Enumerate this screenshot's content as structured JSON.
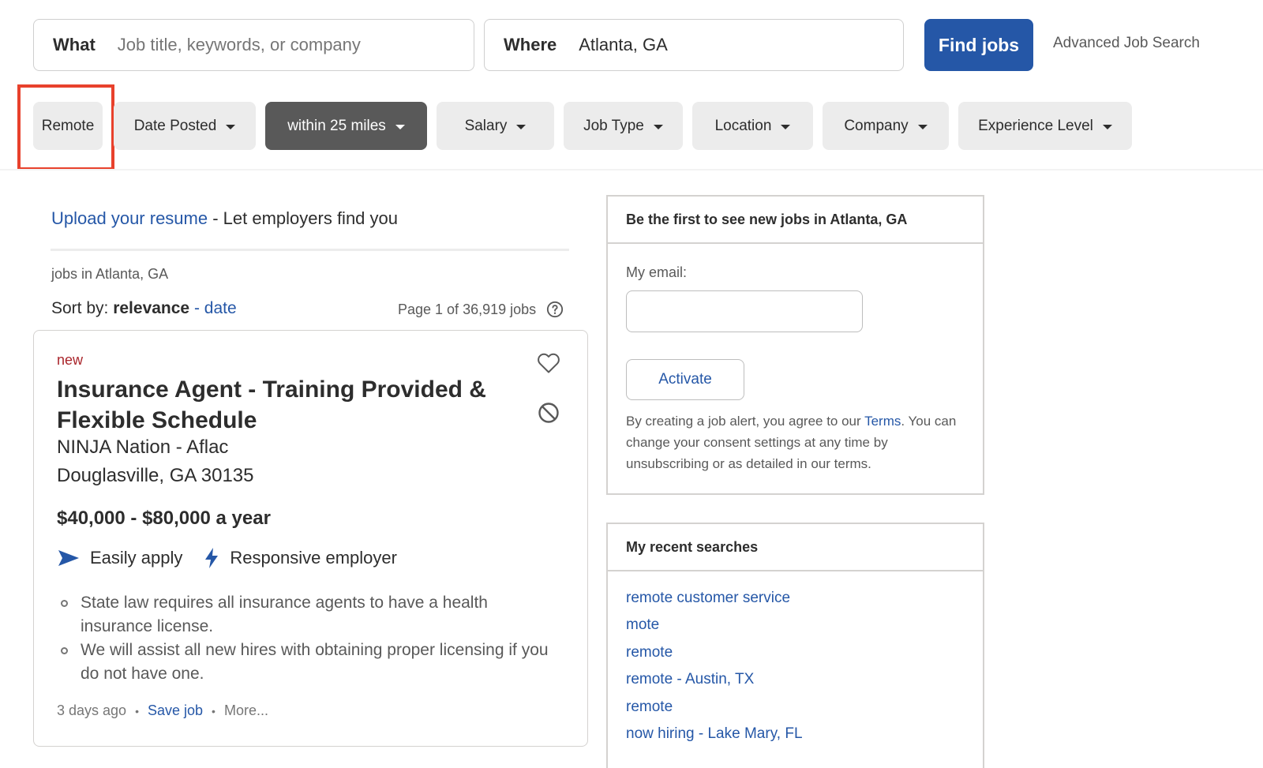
{
  "search": {
    "what_label": "What",
    "what_placeholder": "Job title, keywords, or company",
    "where_label": "Where",
    "where_value": "Atlanta, GA",
    "find_button": "Find jobs",
    "advanced_link": "Advanced Job Search"
  },
  "filters": {
    "remote": "Remote",
    "date_posted": "Date Posted",
    "distance": "within 25 miles",
    "salary": "Salary",
    "job_type": "Job Type",
    "location": "Location",
    "company": "Company",
    "experience": "Experience Level"
  },
  "colors": {
    "brand_blue": "#2557a7",
    "highlight_red": "#e8412c",
    "new_tag": "#a9252b"
  },
  "results": {
    "upload_link": "Upload your resume",
    "upload_rest": " - Let employers find you",
    "jobs_in": "jobs in Atlanta, GA",
    "sort_label": "Sort by: ",
    "sort_relevance": "relevance",
    "sort_dash": " - ",
    "sort_date": "date",
    "page_count": "Page 1 of 36,919 jobs"
  },
  "job": {
    "new_tag": "new",
    "title": "Insurance Agent - Training Provided & Flexible Schedule",
    "company": "NINJA Nation - Aflac",
    "location": "Douglasville, GA 30135",
    "salary": "$40,000 - $80,000 a year",
    "badge_apply": "Easily apply",
    "badge_responsive": "Responsive employer",
    "snippets": [
      "State law requires all insurance agents to have a health insurance license.",
      "We will assist all new hires with obtaining proper licensing if you do not have one."
    ],
    "posted": "3 days ago",
    "save": "Save job",
    "more": "More..."
  },
  "alert": {
    "heading": "Be the first to see new jobs in Atlanta, GA",
    "email_label": "My email:",
    "activate": "Activate",
    "consent_before": "By creating a job alert, you agree to our ",
    "consent_terms": "Terms",
    "consent_after": ". You can change your consent settings at any time by unsubscribing or as detailed in our terms."
  },
  "recent": {
    "heading": "My recent searches",
    "items": [
      "remote customer service",
      "mote",
      "remote",
      "remote - Austin, TX",
      "remote",
      "now hiring - Lake Mary, FL"
    ]
  }
}
